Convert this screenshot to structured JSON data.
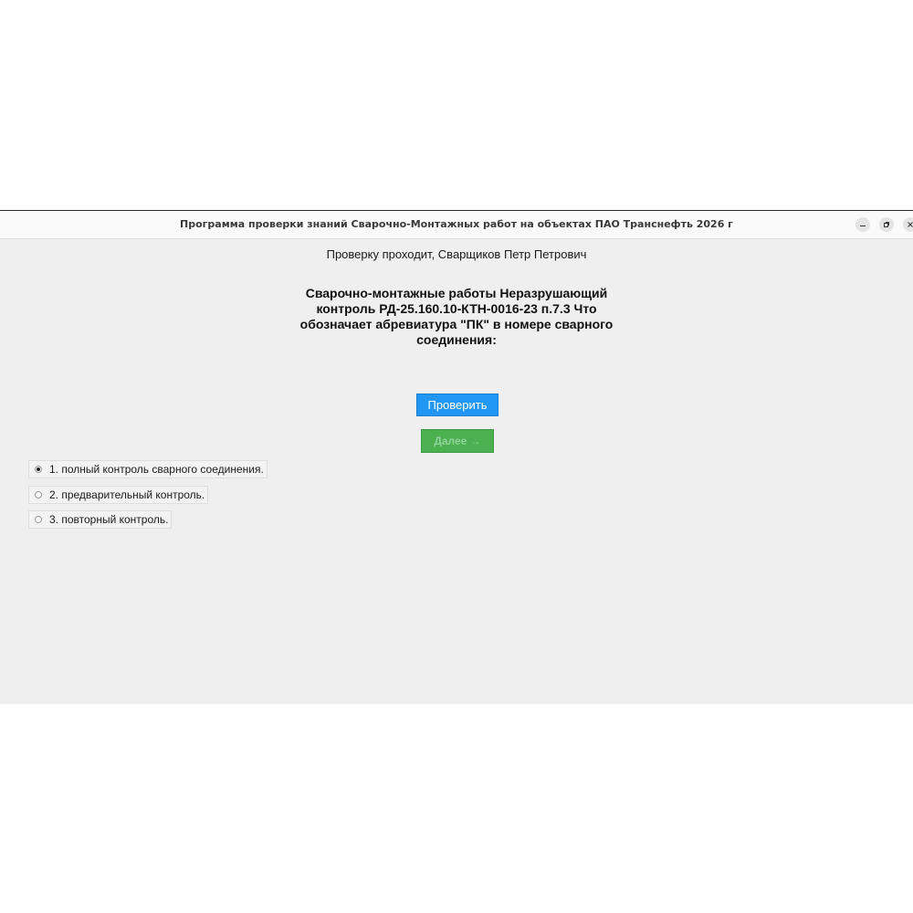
{
  "window": {
    "title": "Программа проверки знаний Сварочно-Монтажных работ на объектах ПАО Транснефть 2026 г",
    "controls": {
      "minimize_icon": "minimize-icon",
      "maximize_icon": "maximize-icon",
      "close_icon": "close-icon"
    }
  },
  "main": {
    "user_line": "Проверку проходит, Сварщиков Петр Петрович",
    "question": "Сварочно-монтажные работы Неразрушающий контроль РД-25.160.10-КТН-0016-23 п.7.3 Что обозначает абревиатура \"ПК\" в номере сварного соединения:",
    "check_button": "Проверить",
    "next_button": "Далее →",
    "options": [
      {
        "label": "1. полный контроль сварного соединения.",
        "selected": true
      },
      {
        "label": "2. предварительный контроль.",
        "selected": false
      },
      {
        "label": "3. повторный контроль.",
        "selected": false
      }
    ]
  },
  "colors": {
    "check_button": "#2196f3",
    "next_button": "#4caf50",
    "window_background": "#efefef"
  }
}
